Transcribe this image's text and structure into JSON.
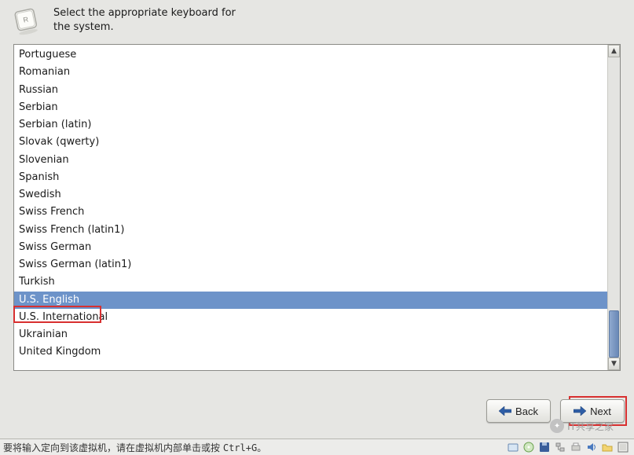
{
  "header": {
    "icon": "keyboard-key-icon",
    "text_line1": "Select the appropriate keyboard for",
    "text_line2": "the system."
  },
  "keyboard_list": {
    "items": [
      "Portuguese",
      "Romanian",
      "Russian",
      "Serbian",
      "Serbian (latin)",
      "Slovak (qwerty)",
      "Slovenian",
      "Spanish",
      "Swedish",
      "Swiss French",
      "Swiss French (latin1)",
      "Swiss German",
      "Swiss German (latin1)",
      "Turkish",
      "U.S. English",
      "U.S. International",
      "Ukrainian",
      "United Kingdom"
    ],
    "selected_index": 14
  },
  "buttons": {
    "back": "Back",
    "next": "Next"
  },
  "status": {
    "hint_text": "要将输入定向到该虚拟机，请在虚拟机内部单击或按",
    "hint_key": "Ctrl+G。"
  },
  "watermark": {
    "text": "IT共享之家"
  },
  "colors": {
    "selection": "#6d93c9",
    "highlight_border": "#d83030"
  }
}
